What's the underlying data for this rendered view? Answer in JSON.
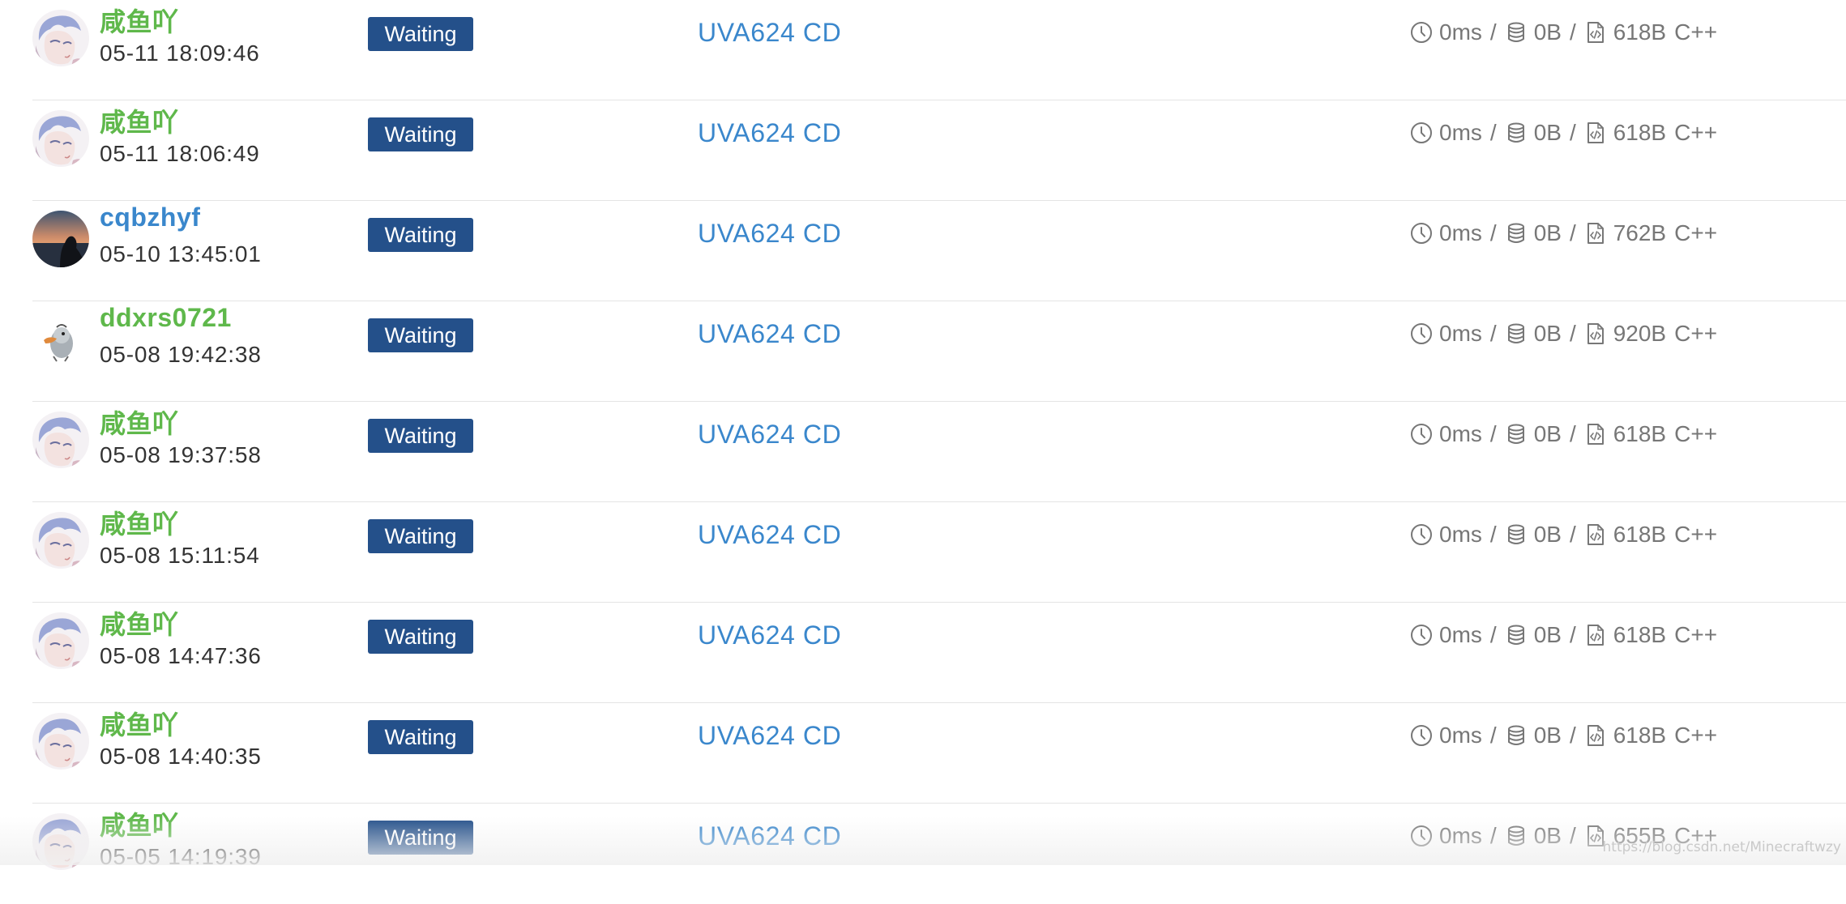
{
  "status_color": "#24508a",
  "username_colors": {
    "green": "#5fb84b",
    "blue": "#3a87cc"
  },
  "icons": [
    "clock-icon",
    "database-icon",
    "code-file-icon"
  ],
  "submissions": [
    {
      "user": "咸鱼吖",
      "user_color": "green",
      "avatar": "anime",
      "time": "05-11 18:09:46",
      "status": "Waiting",
      "problem": "UVA624 CD",
      "runtime": "0ms",
      "memory": "0B",
      "code_size": "618B",
      "language": "C++"
    },
    {
      "user": "咸鱼吖",
      "user_color": "green",
      "avatar": "anime",
      "time": "05-11 18:06:49",
      "status": "Waiting",
      "problem": "UVA624 CD",
      "runtime": "0ms",
      "memory": "0B",
      "code_size": "618B",
      "language": "C++"
    },
    {
      "user": "cqbzhyf",
      "user_color": "blue",
      "avatar": "sunset",
      "time": "05-10 13:45:01",
      "status": "Waiting",
      "problem": "UVA624 CD",
      "runtime": "0ms",
      "memory": "0B",
      "code_size": "762B",
      "language": "C++"
    },
    {
      "user": "ddxrs0721",
      "user_color": "green",
      "avatar": "duck",
      "time": "05-08 19:42:38",
      "status": "Waiting",
      "problem": "UVA624 CD",
      "runtime": "0ms",
      "memory": "0B",
      "code_size": "920B",
      "language": "C++"
    },
    {
      "user": "咸鱼吖",
      "user_color": "green",
      "avatar": "anime",
      "time": "05-08 19:37:58",
      "status": "Waiting",
      "problem": "UVA624 CD",
      "runtime": "0ms",
      "memory": "0B",
      "code_size": "618B",
      "language": "C++"
    },
    {
      "user": "咸鱼吖",
      "user_color": "green",
      "avatar": "anime",
      "time": "05-08 15:11:54",
      "status": "Waiting",
      "problem": "UVA624 CD",
      "runtime": "0ms",
      "memory": "0B",
      "code_size": "618B",
      "language": "C++"
    },
    {
      "user": "咸鱼吖",
      "user_color": "green",
      "avatar": "anime",
      "time": "05-08 14:47:36",
      "status": "Waiting",
      "problem": "UVA624 CD",
      "runtime": "0ms",
      "memory": "0B",
      "code_size": "618B",
      "language": "C++"
    },
    {
      "user": "咸鱼吖",
      "user_color": "green",
      "avatar": "anime",
      "time": "05-08 14:40:35",
      "status": "Waiting",
      "problem": "UVA624 CD",
      "runtime": "0ms",
      "memory": "0B",
      "code_size": "618B",
      "language": "C++"
    },
    {
      "user": "咸鱼吖",
      "user_color": "green",
      "avatar": "anime",
      "time": "05-05 14:19:39",
      "status": "Waiting",
      "problem": "UVA624 CD",
      "runtime": "0ms",
      "memory": "0B",
      "code_size": "655B",
      "language": "C++"
    }
  ],
  "watermark": "https://blog.csdn.net/Minecraftwzy"
}
